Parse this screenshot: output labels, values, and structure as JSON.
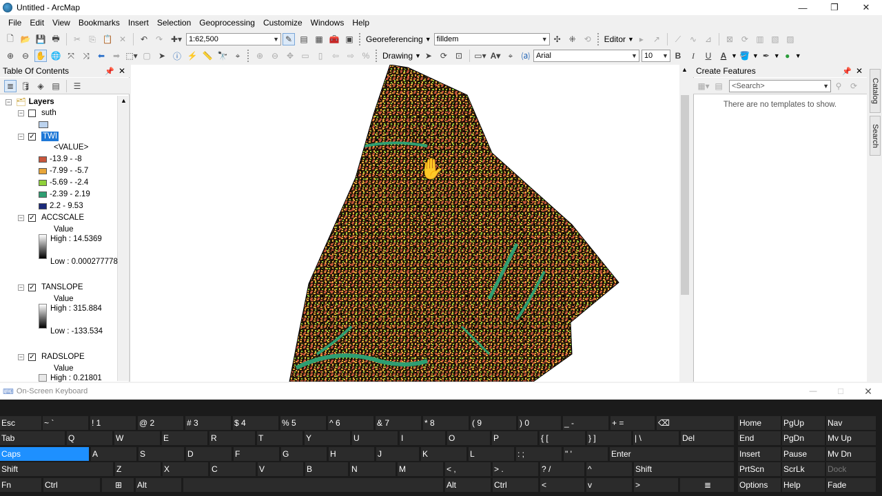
{
  "window": {
    "title": "Untitled - ArcMap",
    "min": "—",
    "max": "❐",
    "close": "✕"
  },
  "menu": [
    "File",
    "Edit",
    "View",
    "Bookmarks",
    "Insert",
    "Selection",
    "Geoprocessing",
    "Customize",
    "Windows",
    "Help"
  ],
  "toolbar1": {
    "scale": "1:62,500",
    "georef_label": "Georeferencing",
    "layer_combo": "filldem",
    "editor_label": "Editor"
  },
  "toolbar2": {
    "drawing_label": "Drawing",
    "font_name": "Arial",
    "font_size": "10",
    "bold": "B",
    "italic": "I",
    "underline": "U",
    "font_color_glyph": "A"
  },
  "toc": {
    "title": "Table Of Contents",
    "root": "Layers",
    "layers": [
      {
        "name": "suth",
        "checked": false
      },
      {
        "name": "TWI",
        "checked": true,
        "selected": true,
        "legend_header": "<VALUE>",
        "classes": [
          {
            "label": "-13.9 - -8",
            "color": "#c8563c"
          },
          {
            "label": "-7.99 - -5.7",
            "color": "#e8a63a"
          },
          {
            "label": "-5.69 - -2.4",
            "color": "#8fd13a"
          },
          {
            "label": "-2.39 - 2.19",
            "color": "#2e9e72"
          },
          {
            "label": "2.2 - 9.53",
            "color": "#1a2a7a"
          }
        ]
      },
      {
        "name": "ACCSCALE",
        "checked": true,
        "value_label": "Value",
        "high": "High : 14.5369",
        "low": "Low : 0.000277778"
      },
      {
        "name": "TANSLOPE",
        "checked": true,
        "value_label": "Value",
        "high": "High : 315.884",
        "low": "Low : -133.534"
      },
      {
        "name": "RADSLOPE",
        "checked": true,
        "value_label": "Value",
        "high": "High : 0.21801"
      }
    ]
  },
  "create_features": {
    "title": "Create Features",
    "search_placeholder": "<Search>",
    "empty_message": "There are no templates to show."
  },
  "side_tabs": [
    "Catalog",
    "Search"
  ],
  "osk": {
    "title": "On-Screen Keyboard",
    "rows": [
      [
        "Esc",
        "~ `",
        "! 1",
        "@ 2",
        "# 3",
        "$ 4",
        "% 5",
        "^ 6",
        "& 7",
        "* 8",
        "( 9",
        ") 0",
        "_ -",
        "+ =",
        "⌫"
      ],
      [
        "Tab",
        "Q",
        "W",
        "E",
        "R",
        "T",
        "Y",
        "U",
        "I",
        "O",
        "P",
        "{ [",
        "} ]",
        "| \\",
        "Del"
      ],
      [
        "Caps",
        "A",
        "S",
        "D",
        "F",
        "G",
        "H",
        "J",
        "K",
        "L",
        ": ;",
        "\" '",
        "Enter"
      ],
      [
        "Shift",
        "Z",
        "X",
        "C",
        "V",
        "B",
        "N",
        "M",
        "< ,",
        "> .",
        "? /",
        "^",
        "Shift"
      ],
      [
        "Fn",
        "Ctrl",
        "⊞",
        "Alt",
        "",
        "Alt",
        "Ctrl",
        "<",
        "v",
        ">",
        "≣"
      ]
    ],
    "nav": [
      [
        "Home",
        "PgUp",
        "Nav"
      ],
      [
        "End",
        "PgDn",
        "Mv Up"
      ],
      [
        "Insert",
        "Pause",
        "Mv Dn"
      ],
      [
        "PrtScn",
        "ScrLk",
        "Dock"
      ],
      [
        "Options",
        "Help",
        "Fade"
      ]
    ]
  }
}
